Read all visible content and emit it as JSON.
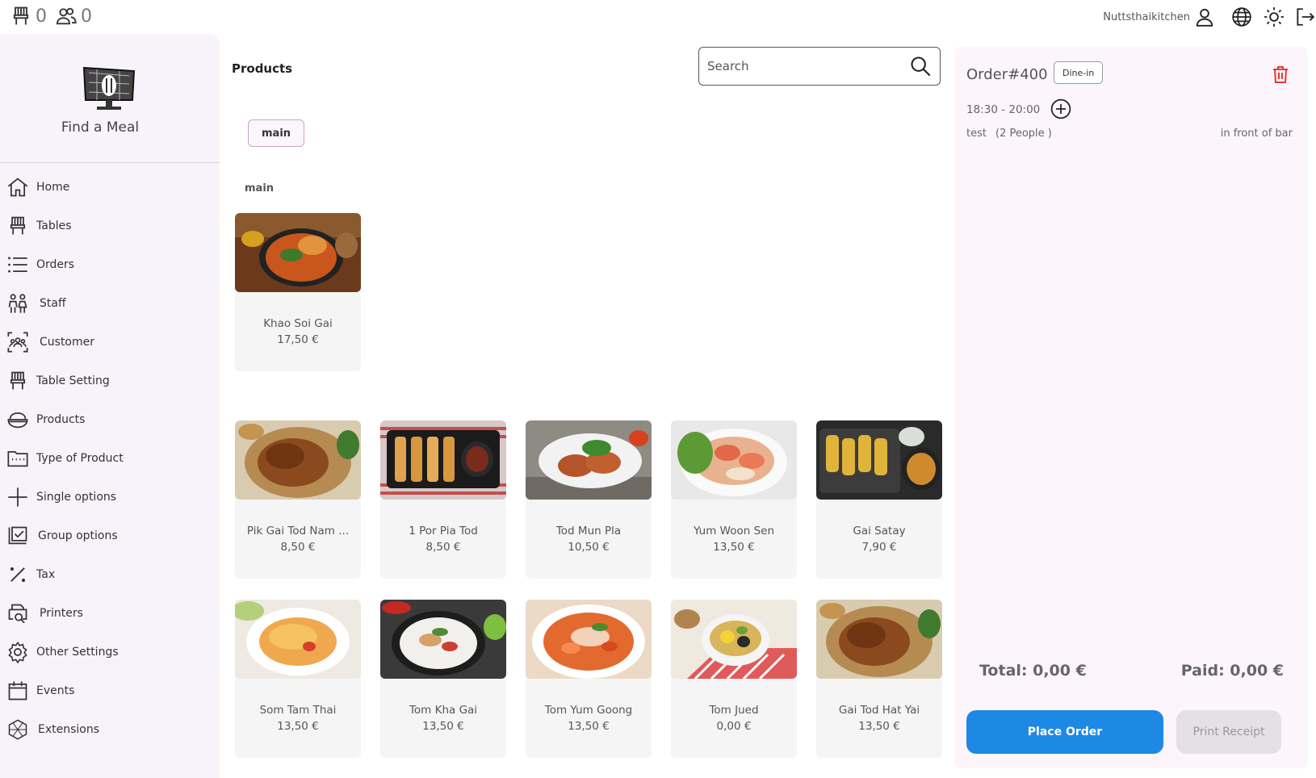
{
  "topbar": {
    "tables_count": "0",
    "guests_count": "0",
    "username": "Nuttsthaikitchen"
  },
  "brand": {
    "name": "Find a Meal"
  },
  "sidebar": {
    "items": [
      {
        "label": "Home",
        "icon": "home-icon"
      },
      {
        "label": "Tables",
        "icon": "chair-icon"
      },
      {
        "label": "Orders",
        "icon": "list-icon"
      },
      {
        "label": "Staff",
        "icon": "staff-icon"
      },
      {
        "label": "Customer",
        "icon": "customer-icon"
      },
      {
        "label": "Table Setting",
        "icon": "chair-icon"
      },
      {
        "label": "Products",
        "icon": "bowl-icon"
      },
      {
        "label": "Type of Product",
        "icon": "folder-icon"
      },
      {
        "label": "Single options",
        "icon": "plus-icon"
      },
      {
        "label": "Group options",
        "icon": "checkbox-icon"
      },
      {
        "label": "Tax",
        "icon": "percent-icon"
      },
      {
        "label": "Printers",
        "icon": "printer-icon"
      },
      {
        "label": "Other Settings",
        "icon": "gear-icon"
      },
      {
        "label": "Events",
        "icon": "calendar-icon"
      },
      {
        "label": "Extensions",
        "icon": "extensions-icon"
      }
    ]
  },
  "main": {
    "title": "Products",
    "search_placeholder": "Search",
    "chip": "main",
    "section": "main",
    "products": [
      {
        "name": "Khao Soi Gai",
        "price": "17,50 €"
      },
      {
        "name": "Pik Gai Tod Nam ...",
        "price": "8,50 €"
      },
      {
        "name": "1 Por Pia Tod",
        "price": "8,50 €"
      },
      {
        "name": "Tod Mun Pla",
        "price": "10,50 €"
      },
      {
        "name": "Yum Woon Sen",
        "price": "13,50 €"
      },
      {
        "name": "Gai Satay",
        "price": "7,90 €"
      },
      {
        "name": "Som Tam Thai",
        "price": "13,50 €"
      },
      {
        "name": "Tom Kha Gai",
        "price": "13,50 €"
      },
      {
        "name": "Tom Yum Goong",
        "price": "13,50 €"
      },
      {
        "name": "Tom Jued",
        "price": "0,00 €"
      },
      {
        "name": "Gai Tod Hat Yai",
        "price": "13,50 €"
      }
    ]
  },
  "order": {
    "title": "Order#400",
    "type": "Dine-in",
    "time": "18:30 - 20:00",
    "guest": "test",
    "people": "(2 People )",
    "location": "in front of bar",
    "total": "Total: 0,00 €",
    "paid": "Paid: 0,00 €",
    "place_label": "Place Order",
    "print_label": "Print Receipt"
  },
  "colors": {
    "accent": "#1e88e5",
    "sidebar_bg": "#f8f3fa",
    "panel_bg": "#fcf6fc",
    "danger": "#e53935"
  }
}
